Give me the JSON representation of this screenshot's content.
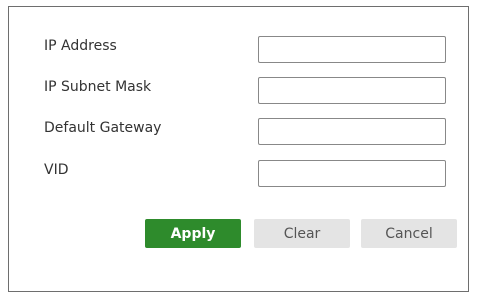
{
  "form": {
    "fields": [
      {
        "label": "IP Address",
        "value": "",
        "placeholder": ""
      },
      {
        "label": "IP Subnet Mask",
        "value": "",
        "placeholder": ""
      },
      {
        "label": "Default Gateway",
        "value": "",
        "placeholder": ""
      },
      {
        "label": "VID",
        "value": "",
        "placeholder": ""
      }
    ]
  },
  "buttons": {
    "apply": "Apply",
    "clear": "Clear",
    "cancel": "Cancel"
  },
  "colors": {
    "apply_bg": "#2e8b2c",
    "secondary_bg": "#e4e4e4",
    "border": "#6e6e6e"
  }
}
